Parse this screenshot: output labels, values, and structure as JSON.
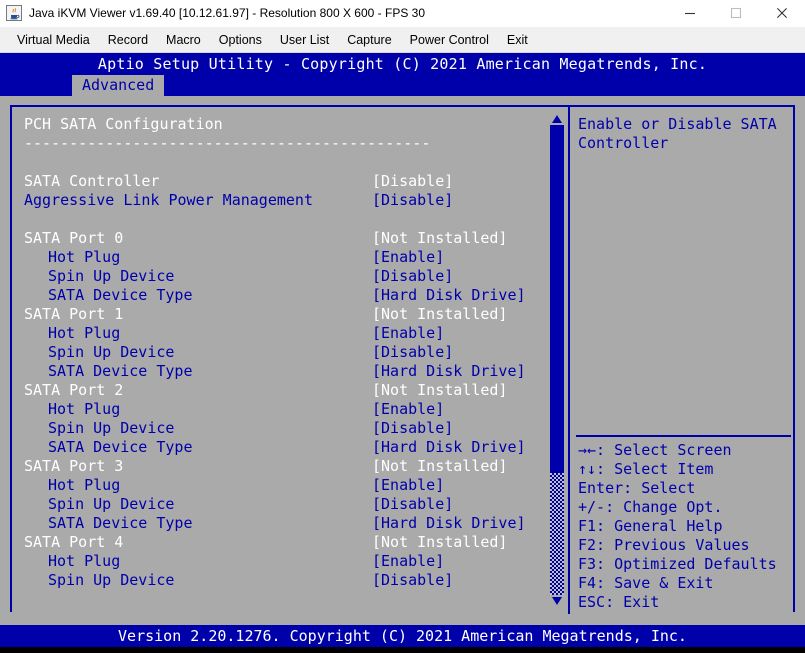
{
  "window": {
    "title": "Java iKVM Viewer v1.69.40 [10.12.61.97]  - Resolution 800 X 600 - FPS 30",
    "icon": "java-coffee-cup-icon",
    "controls": {
      "minimize": "minimize-icon",
      "maximize": "maximize-icon",
      "close": "close-icon"
    }
  },
  "menu": {
    "items": [
      {
        "label": "Virtual Media"
      },
      {
        "label": "Record"
      },
      {
        "label": "Macro"
      },
      {
        "label": "Options"
      },
      {
        "label": "User List"
      },
      {
        "label": "Capture"
      },
      {
        "label": "Power Control"
      },
      {
        "label": "Exit"
      }
    ]
  },
  "bios": {
    "title": "Aptio Setup Utility - Copyright (C) 2021 American Megatrends, Inc.",
    "tabs": [
      {
        "label": "Advanced",
        "selected": true
      }
    ],
    "section_title": "PCH SATA Configuration",
    "section_rule": "---------------------------------------------",
    "rows": [
      {
        "label": "PCH SATA Configuration",
        "value": "",
        "label_color": "white",
        "value_color": "white",
        "indent": false,
        "kind": "heading"
      },
      {
        "label": "---------------------------------------------",
        "value": "",
        "label_color": "white",
        "value_color": "white",
        "indent": false,
        "kind": "rule"
      },
      {
        "label": "",
        "value": "",
        "label_color": "white",
        "value_color": "white",
        "indent": false,
        "kind": "spacer"
      },
      {
        "label": "SATA Controller",
        "value": "[Disable]",
        "label_color": "white",
        "value_color": "white",
        "indent": false,
        "kind": "option"
      },
      {
        "label": "Aggressive Link Power Management",
        "value": "[Disable]",
        "label_color": "blue",
        "value_color": "blue",
        "indent": false,
        "kind": "option"
      },
      {
        "label": "",
        "value": "",
        "label_color": "white",
        "value_color": "white",
        "indent": false,
        "kind": "spacer"
      },
      {
        "label": "SATA Port 0",
        "value": "[Not Installed]",
        "label_color": "white",
        "value_color": "white",
        "indent": false,
        "kind": "port"
      },
      {
        "label": "Hot Plug",
        "value": "[Enable]",
        "label_color": "blue",
        "value_color": "blue",
        "indent": true,
        "kind": "option"
      },
      {
        "label": "Spin Up Device",
        "value": "[Disable]",
        "label_color": "blue",
        "value_color": "blue",
        "indent": true,
        "kind": "option"
      },
      {
        "label": "SATA Device Type",
        "value": "[Hard Disk Drive]",
        "label_color": "blue",
        "value_color": "blue",
        "indent": true,
        "kind": "option"
      },
      {
        "label": "SATA Port 1",
        "value": "[Not Installed]",
        "label_color": "white",
        "value_color": "white",
        "indent": false,
        "kind": "port"
      },
      {
        "label": "Hot Plug",
        "value": "[Enable]",
        "label_color": "blue",
        "value_color": "blue",
        "indent": true,
        "kind": "option"
      },
      {
        "label": "Spin Up Device",
        "value": "[Disable]",
        "label_color": "blue",
        "value_color": "blue",
        "indent": true,
        "kind": "option"
      },
      {
        "label": "SATA Device Type",
        "value": "[Hard Disk Drive]",
        "label_color": "blue",
        "value_color": "blue",
        "indent": true,
        "kind": "option"
      },
      {
        "label": "SATA Port 2",
        "value": "[Not Installed]",
        "label_color": "white",
        "value_color": "white",
        "indent": false,
        "kind": "port"
      },
      {
        "label": "Hot Plug",
        "value": "[Enable]",
        "label_color": "blue",
        "value_color": "blue",
        "indent": true,
        "kind": "option"
      },
      {
        "label": "Spin Up Device",
        "value": "[Disable]",
        "label_color": "blue",
        "value_color": "blue",
        "indent": true,
        "kind": "option"
      },
      {
        "label": "SATA Device Type",
        "value": "[Hard Disk Drive]",
        "label_color": "blue",
        "value_color": "blue",
        "indent": true,
        "kind": "option"
      },
      {
        "label": "SATA Port 3",
        "value": "[Not Installed]",
        "label_color": "white",
        "value_color": "white",
        "indent": false,
        "kind": "port"
      },
      {
        "label": "Hot Plug",
        "value": "[Enable]",
        "label_color": "blue",
        "value_color": "blue",
        "indent": true,
        "kind": "option"
      },
      {
        "label": "Spin Up Device",
        "value": "[Disable]",
        "label_color": "blue",
        "value_color": "blue",
        "indent": true,
        "kind": "option"
      },
      {
        "label": "SATA Device Type",
        "value": "[Hard Disk Drive]",
        "label_color": "blue",
        "value_color": "blue",
        "indent": true,
        "kind": "option"
      },
      {
        "label": "SATA Port 4",
        "value": "[Not Installed]",
        "label_color": "white",
        "value_color": "white",
        "indent": false,
        "kind": "port"
      },
      {
        "label": "Hot Plug",
        "value": "[Enable]",
        "label_color": "blue",
        "value_color": "blue",
        "indent": true,
        "kind": "option"
      },
      {
        "label": "Spin Up Device",
        "value": "[Disable]",
        "label_color": "blue",
        "value_color": "blue",
        "indent": true,
        "kind": "option"
      }
    ],
    "help_text": "Enable or Disable SATA Controller",
    "key_legend": [
      {
        "key": "→←",
        "desc": ": Select Screen"
      },
      {
        "key": "↑↓",
        "desc": ": Select Item"
      },
      {
        "key": "Enter",
        "desc": ": Select"
      },
      {
        "key": "+/-",
        "desc": ": Change Opt."
      },
      {
        "key": "F1",
        "desc": ": General Help"
      },
      {
        "key": "F2",
        "desc": ": Previous Values"
      },
      {
        "key": "F3",
        "desc": ": Optimized Defaults"
      },
      {
        "key": "F4",
        "desc": ": Save & Exit"
      },
      {
        "key": "ESC",
        "desc": ": Exit"
      }
    ],
    "footer": "Version 2.20.1276. Copyright (C) 2021 American Megatrends, Inc.",
    "scrollbar": {
      "up_arrow": "triangle-up-icon",
      "down_arrow": "triangle-down-icon",
      "thumb_percent": 74
    },
    "colors": {
      "background_blue": "#0000aa",
      "panel_grey": "#aaaaaa",
      "text_white": "#ffffff",
      "text_blue": "#0000aa"
    }
  }
}
